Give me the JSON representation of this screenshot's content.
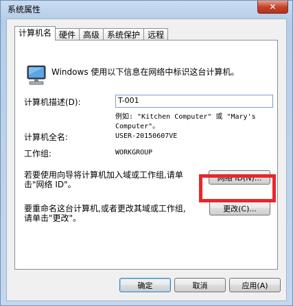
{
  "window": {
    "title": "系统属性",
    "close_label": "✕"
  },
  "tabs": [
    "计算机名",
    "硬件",
    "高级",
    "系统保护",
    "远程"
  ],
  "panel": {
    "intro": "Windows 使用以下信息在网络中标识这台计算机。",
    "description_label": "计算机描述(D):",
    "description_value": "T-001",
    "example_line1": "例如: \"Kitchen Computer\" 或 \"Mary's",
    "example_line2": "Computer\"。",
    "fullname_label": "计算机全名:",
    "fullname_value": "USER-20150607VE",
    "workgroup_label": "工作组:",
    "workgroup_value": "WORKGROUP",
    "network_text_line1": "若要使用向导将计算机加入域或工作组,请单",
    "network_text_line2": "击\"网络 ID\"。",
    "network_button": "网络 ID(N)...",
    "rename_text_line1": "要重命名这台计算机,或者更改其域或工作组,",
    "rename_text_line2": "请单击\"更改\"。",
    "change_button": "更改(C)..."
  },
  "footer": {
    "ok": "确定",
    "cancel": "取消",
    "apply": "应用(A)"
  }
}
